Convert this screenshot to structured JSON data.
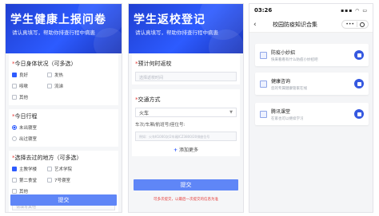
{
  "colors": {
    "brand_blue": "#2d5bff",
    "button_blue": "#5f86f7",
    "warning_red": "#e53935"
  },
  "health_form": {
    "title": "学生健康上报问卷",
    "subtitle": "请认真填写，帮助你排查行程中病患",
    "q1": {
      "label": "今日身体状况（可多选）",
      "options": [
        "良好",
        "发热",
        "咳嗽",
        "流涕",
        "其他"
      ]
    },
    "q2": {
      "label": "今日行程",
      "options": [
        "未出寝室",
        "出过寝室"
      ]
    },
    "q3": {
      "label": "选择去过的地方（可多选）",
      "options": [
        "主教学楼",
        "艺术学院",
        "第二食堂",
        "7号寝室",
        "其他"
      ]
    },
    "other_placeholder": "请填写其他",
    "submit_label": "提交"
  },
  "return_form": {
    "title": "学生返校登记",
    "subtitle": "请认真填写，帮助你排查行程中病患",
    "q1": {
      "label": "预计何时返校",
      "placeholder": "选择返校时间"
    },
    "q2": {
      "label": "交通方式",
      "selected": "火车",
      "detail_label": "车次/车厢/航班号/座位号:",
      "detail_placeholder": "例如：火车K1000次/2车厢/CZ3800/20排座位号"
    },
    "add_more": "添加更多",
    "submit_label": "提交",
    "warning": "可多次提交，以最后一次提交的信息为准"
  },
  "mini_program": {
    "status": {
      "time": "03:26",
      "icons": "▪▪▪ ◠ ▭"
    },
    "nav": {
      "back": "‹",
      "title": "校园防疫知识合集"
    },
    "cards": [
      {
        "name": "防疫小妙招",
        "desc": "快来看看有什么防疫小妙招吧",
        "icon": "doc-icon"
      },
      {
        "name": "健康咨询",
        "desc": "您的专属健康管家在线",
        "icon": "chat-icon"
      },
      {
        "name": "腾讯课堂",
        "desc": "在家也可以继续学习",
        "icon": "class-icon"
      }
    ]
  }
}
